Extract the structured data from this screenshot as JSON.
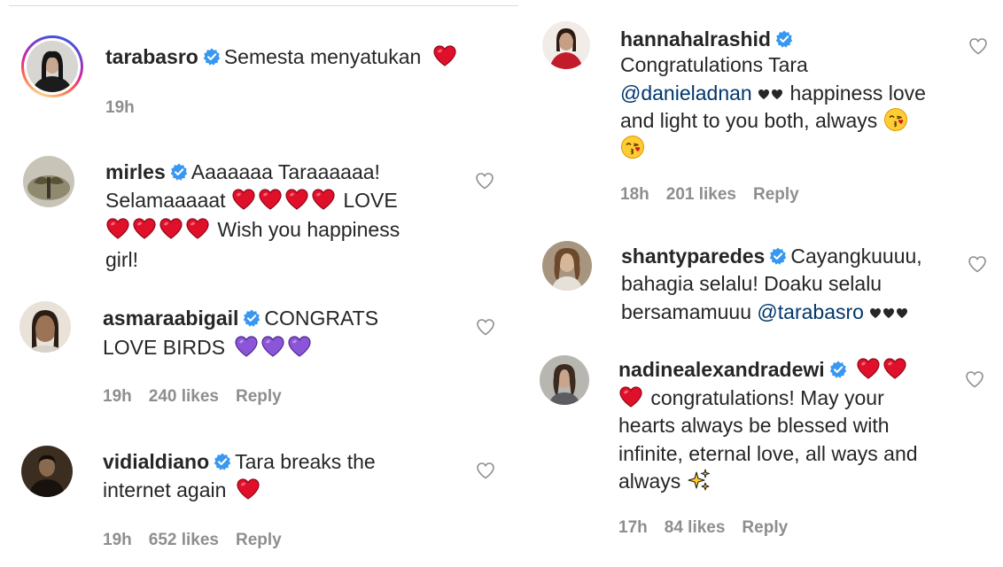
{
  "left": {
    "c1": {
      "user": "tarabasro",
      "text": "Semesta menyatukan",
      "time": "19h"
    },
    "c2": {
      "user": "mirles",
      "line1": "Aaaaaaa Taraaaaaa!",
      "line2a": "Selamaaaaat",
      "line2b": "LOVE",
      "line3": "Wish you happiness",
      "line4": "girl!"
    },
    "c3": {
      "user": "asmaraabigail",
      "line1": "CONGRATS",
      "line2": "LOVE BIRDS",
      "time": "19h",
      "likes": "240 likes",
      "reply": "Reply"
    },
    "c4": {
      "user": "vidialdiano",
      "line1": "Tara breaks the",
      "line2": "internet again",
      "time": "19h",
      "likes": "652 likes",
      "reply": "Reply"
    }
  },
  "right": {
    "c1": {
      "user": "hannahalrashid",
      "line1": "Congratulations Tara",
      "mention": "@danieladnan",
      "line2b": "happiness love",
      "line3": "and light to you both, always",
      "time": "18h",
      "likes": "201 likes",
      "reply": "Reply"
    },
    "c2": {
      "user": "shantyparedes",
      "line1": "Cayangkuuuu,",
      "line2": "bahagia selalu! Doaku selalu",
      "line3a": "bersamamuuu",
      "mention": "@tarabasro"
    },
    "c3": {
      "user": "nadinealexandradewi",
      "line2": "congratulations! May your",
      "line3": "hearts always be blessed with",
      "line4": "infinite, eternal love, all ways and",
      "line5": "always",
      "time": "17h",
      "likes": "84 likes",
      "reply": "Reply"
    }
  },
  "colors": {
    "text": "#262626",
    "meta": "#8e8e8e",
    "mention": "#00376b",
    "verified": "#3897f0",
    "heart_red": "#e0102a",
    "heart_purple": "#8a55d7"
  },
  "icons": [
    "verified-badge-icon",
    "like-heart-outline-icon",
    "red-heart-emoji",
    "purple-heart-emoji",
    "black-heart-emoji",
    "kiss-face-emoji",
    "sparkles-emoji"
  ]
}
